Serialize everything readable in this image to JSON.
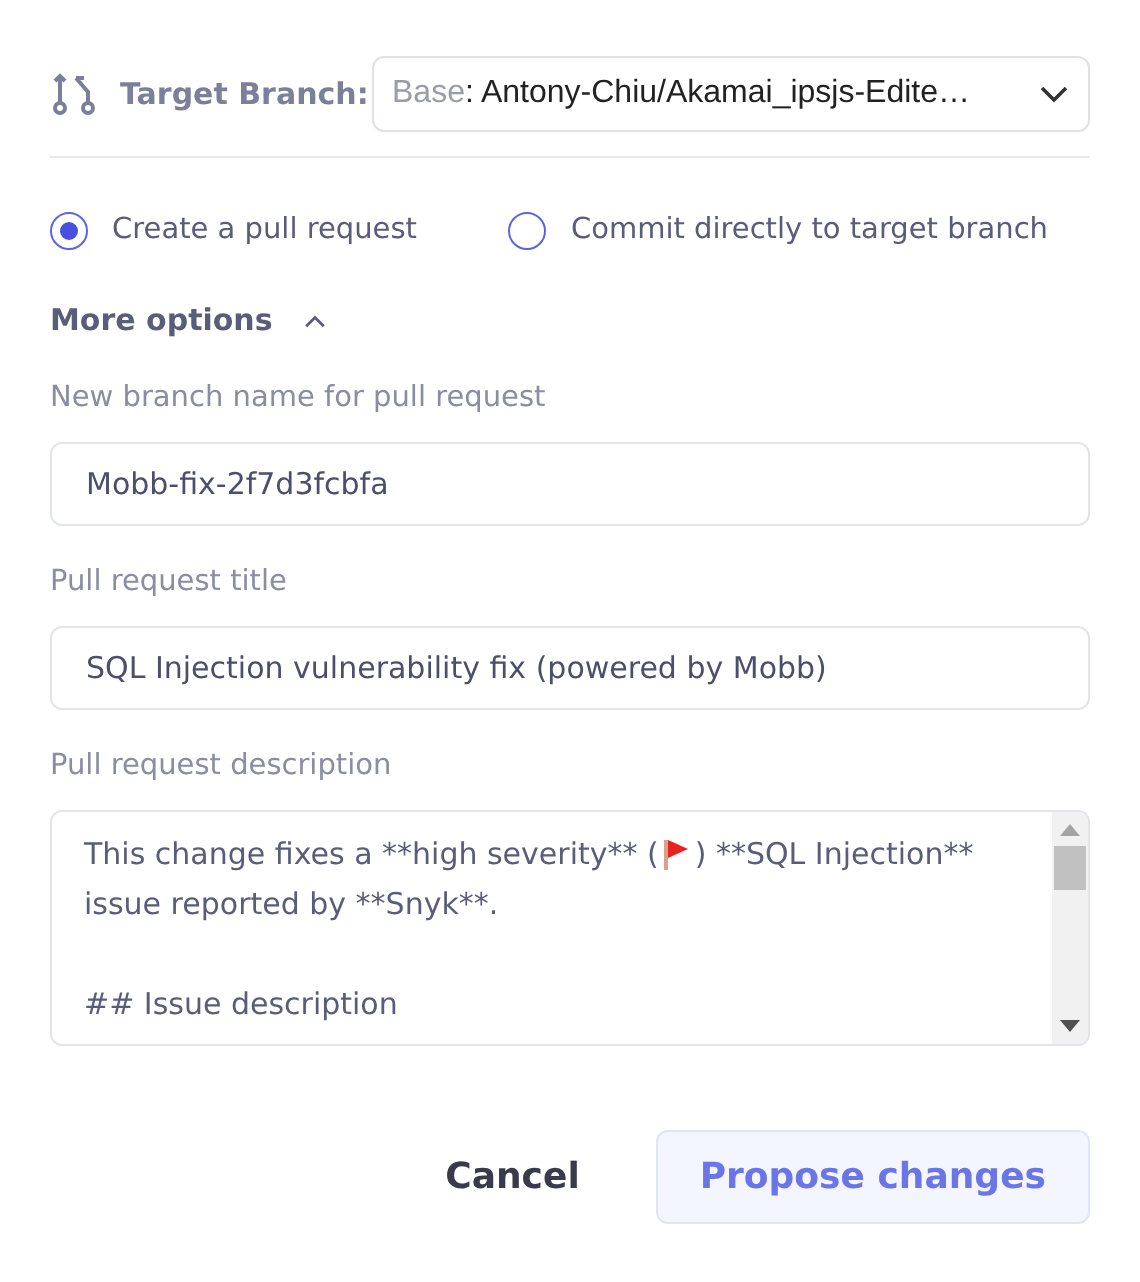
{
  "target_branch": {
    "label": "Target Branch:",
    "prefix": "Base",
    "value": ": Antony-Chiu/Akamai_ipsjs-Edite…"
  },
  "mode_options": [
    {
      "label": "Create a pull request",
      "selected": true
    },
    {
      "label": "Commit directly to target branch",
      "selected": false
    }
  ],
  "more_options": {
    "label": "More options",
    "expanded": true
  },
  "fields": [
    {
      "label": "New branch name for pull request",
      "value": "Mobb-fix-2f7d3fcbfa"
    },
    {
      "label": "Pull request title",
      "value": "SQL Injection vulnerability fix (powered by Mobb)"
    }
  ],
  "description": {
    "label": "Pull request description",
    "lines": [
      {
        "segments": [
          {
            "kind": "text",
            "text": "This change fixes a **high severity** ("
          },
          {
            "kind": "flag"
          },
          {
            "kind": "text",
            "text": ") **SQL Injection**"
          }
        ]
      },
      {
        "segments": [
          {
            "kind": "text",
            "text": "issue reported by **Snyk**."
          }
        ]
      },
      {
        "kind": "blank"
      },
      {
        "segments": [
          {
            "kind": "text",
            "text": "## Issue description"
          }
        ]
      }
    ]
  },
  "buttons": [
    {
      "label": "Cancel",
      "kind": "plain"
    },
    {
      "label": "Propose changes",
      "kind": "primary"
    }
  ]
}
